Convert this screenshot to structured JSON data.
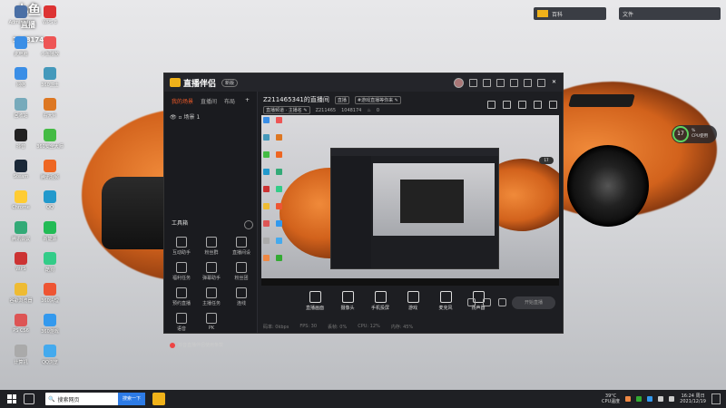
{
  "desktop_icons": [
    {
      "label": "Administ...",
      "color": "#4a6fa5"
    },
    {
      "label": "WPS 8",
      "color": "#d33"
    },
    {
      "label": "此电脑",
      "color": "#3a8ee6"
    },
    {
      "label": "小鱼播放",
      "color": "#e55"
    },
    {
      "label": "网络",
      "color": "#3a8ee6"
    },
    {
      "label": "360卫士",
      "color": "#49b"
    },
    {
      "label": "回收站",
      "color": "#7ab"
    },
    {
      "label": "看大片",
      "color": "#d72"
    },
    {
      "label": "抖音",
      "color": "#222"
    },
    {
      "label": "360安全大师",
      "color": "#4b4"
    },
    {
      "label": "Steam",
      "color": "#1b2838"
    },
    {
      "label": "腾讯视频",
      "color": "#e62"
    },
    {
      "label": "Chrome",
      "color": "#fc3"
    },
    {
      "label": "QQ",
      "color": "#29c"
    },
    {
      "label": "腾讯会议",
      "color": "#3a7"
    },
    {
      "label": "新能源",
      "color": "#2b5"
    },
    {
      "label": "WPS",
      "color": "#c33"
    },
    {
      "label": "酷狗",
      "color": "#3c8"
    },
    {
      "label": "谷歌浏览器",
      "color": "#eb3"
    },
    {
      "label": "360清理",
      "color": "#e53"
    },
    {
      "label": "PS CS6",
      "color": "#d55"
    },
    {
      "label": "360游戏",
      "color": "#39e"
    },
    {
      "label": "计算机",
      "color": "#aaa"
    },
    {
      "label": "QQ浏览",
      "color": "#4ae"
    }
  ],
  "watermark": {
    "line1": "小鱼",
    "line2": "直播",
    "id": "1048174"
  },
  "top_widgets": [
    {
      "text": "百科"
    },
    {
      "text": "文件"
    }
  ],
  "app": {
    "name": "直播伴侣",
    "badge": "新版",
    "left_tabs": [
      "我的场景",
      "直播间",
      "布局"
    ],
    "scene": "场景 1",
    "tools_title": "工具箱",
    "tools": [
      "互动助手",
      "粉丝群",
      "直播间设",
      "福利任务",
      "弹幕助手",
      "粉丝团",
      "预约直播",
      "主播任务",
      "连线",
      "语音",
      "PK"
    ],
    "notice": "抖音直播伴侣使用条款",
    "room_title": "Z211465341的直播间",
    "room_chip1": "直播",
    "room_chip2": "#游戏直播等你来 ✎",
    "room_line2_a": "直播频道 · 主播名 ✎",
    "room_id": "Z211465",
    "room_num": "1048174",
    "room_count": "0",
    "controls": [
      "直播画面",
      "摄像头",
      "手机投屏",
      "游戏",
      "麦克风",
      "扬声器"
    ],
    "go_live": "开始直播",
    "status": [
      "码率: 0kbps",
      "FPS: 30",
      "丢帧: 0%",
      "CPU: 12%",
      "内存: 45%"
    ]
  },
  "cpu_widget": {
    "value": "17",
    "unit": "%",
    "label": "CPU使用"
  },
  "taskbar": {
    "search_text": "搜索网页",
    "search_button": "搜索一下",
    "temp": "39°C",
    "temp_label": "CPU温度",
    "time": "16:24 周日",
    "date": "2021/12/19"
  }
}
